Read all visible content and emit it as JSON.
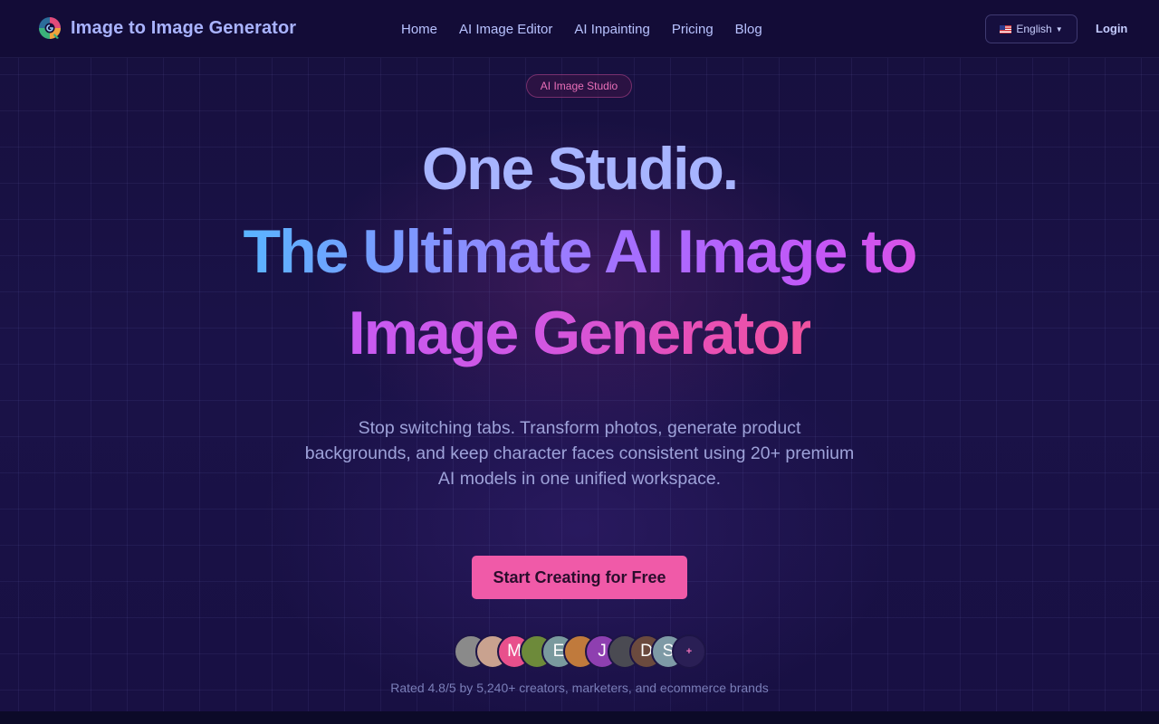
{
  "header": {
    "logo_text": "Image to Image Generator",
    "nav": [
      "Home",
      "AI Image Editor",
      "AI Inpainting",
      "Pricing",
      "Blog"
    ],
    "language": "English",
    "login": "Login"
  },
  "hero": {
    "pill": "AI Image Studio",
    "line1": "One Studio.",
    "line2": "The Ultimate AI Image to",
    "line3": "Image Generator",
    "subtitle_1": "Stop switching tabs. Transform photos, generate product",
    "subtitle_2": "backgrounds, and keep character faces consistent using 20+ premium",
    "subtitle_3": "AI models in one unified workspace.",
    "cta": "Start Creating for Free",
    "avatars": [
      {
        "letter": "",
        "color": "#8a8a8a"
      },
      {
        "letter": "",
        "color": "#c9a28f"
      },
      {
        "letter": "M",
        "color": "#e8508c"
      },
      {
        "letter": "",
        "color": "#6d8a3a"
      },
      {
        "letter": "E",
        "color": "#7a9a9e"
      },
      {
        "letter": "",
        "color": "#c07a3c"
      },
      {
        "letter": "J",
        "color": "#8e3fb0"
      },
      {
        "letter": "",
        "color": "#4a4a52"
      },
      {
        "letter": "D",
        "color": "#6b4a3e"
      },
      {
        "letter": "S",
        "color": "#7e9aa6"
      },
      {
        "letter": "+",
        "color": "#2a1f55"
      }
    ],
    "rating": "Rated 4.8/5 by 5,240+ creators, marketers, and ecommerce brands"
  },
  "colors": {
    "background": "#120d35",
    "accent_pink": "#f05aa8",
    "logo_text": "#a9b3ff"
  }
}
